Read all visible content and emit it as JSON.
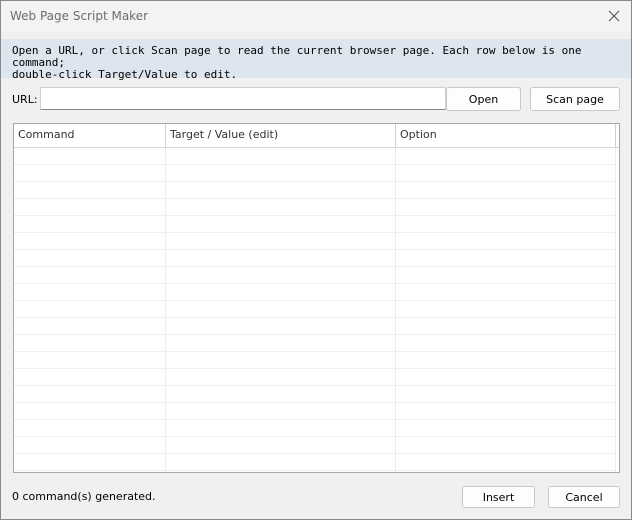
{
  "window": {
    "title": "Web Page Script Maker"
  },
  "info": {
    "text": "Open a URL, or click Scan page to read the current browser page. Each row below is one command;\ndouble-click Target/Value to edit."
  },
  "url": {
    "label": "URL:",
    "value": "",
    "placeholder": ""
  },
  "buttons": {
    "open": "Open",
    "scan": "Scan page",
    "insert": "Insert",
    "cancel": "Cancel"
  },
  "grid": {
    "columns": [
      "Command",
      "Target / Value (edit)",
      "Option"
    ],
    "rows": []
  },
  "status": {
    "text": "0 command(s) generated."
  },
  "icons": {
    "close": "close-icon"
  }
}
